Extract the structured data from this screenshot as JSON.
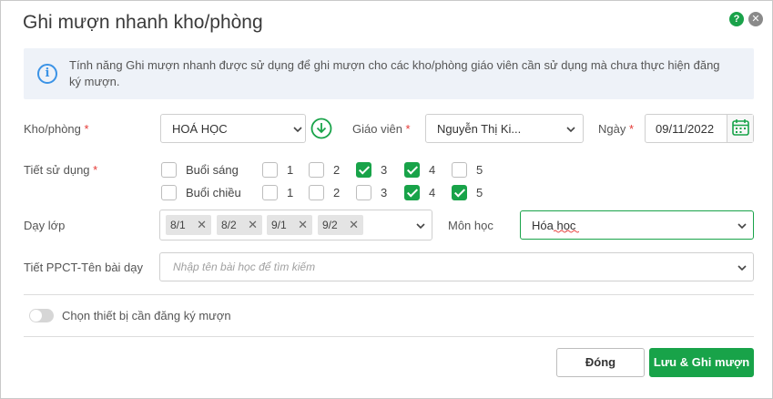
{
  "dialog": {
    "title": "Ghi mượn nhanh kho/phòng",
    "help_glyph": "?",
    "close_glyph": "✕"
  },
  "info": {
    "icon_glyph": "i",
    "text": "Tính năng Ghi mượn nhanh được sử dụng để ghi mượn cho các kho/phòng giáo viên cần sử dụng mà chưa thực hiện đăng ký mượn."
  },
  "form": {
    "kho_phong": {
      "label": "Kho/phòng",
      "required_mark": "*",
      "value": "HOÁ HỌC"
    },
    "giao_vien": {
      "label": "Giáo viên",
      "required_mark": "*",
      "value": "Nguyễn Thị Ki..."
    },
    "ngay": {
      "label": "Ngày",
      "required_mark": "*",
      "value": "09/11/2022"
    },
    "tiet_su_dung": {
      "label": "Tiết sử dụng",
      "required_mark": "*",
      "rows": [
        {
          "session": "Buổi sáng",
          "session_checked": false,
          "periods": [
            {
              "label": "1",
              "checked": false
            },
            {
              "label": "2",
              "checked": false
            },
            {
              "label": "3",
              "checked": true
            },
            {
              "label": "4",
              "checked": true
            },
            {
              "label": "5",
              "checked": false
            }
          ]
        },
        {
          "session": "Buổi chiều",
          "session_checked": false,
          "periods": [
            {
              "label": "1",
              "checked": false
            },
            {
              "label": "2",
              "checked": false
            },
            {
              "label": "3",
              "checked": false
            },
            {
              "label": "4",
              "checked": true
            },
            {
              "label": "5",
              "checked": true
            }
          ]
        }
      ]
    },
    "day_lop": {
      "label": "Dạy lớp",
      "tags": [
        "8/1",
        "8/2",
        "9/1",
        "9/2"
      ],
      "remove_glyph": "✕"
    },
    "mon_hoc": {
      "label": "Môn học",
      "value": "Hóa học"
    },
    "ppct": {
      "label": "Tiết PPCT-Tên bài dạy",
      "placeholder": "Nhập tên bài học để tìm kiếm"
    },
    "toggle": {
      "label": "Chọn thiết bị cần đăng ký mượn",
      "on": false
    }
  },
  "buttons": {
    "close": "Đóng",
    "save": "Lưu & Ghi mượn"
  },
  "colors": {
    "accent": "#18a349",
    "required": "#e53935",
    "info_bg": "#eef2f8",
    "info_icon": "#3b93e6"
  }
}
